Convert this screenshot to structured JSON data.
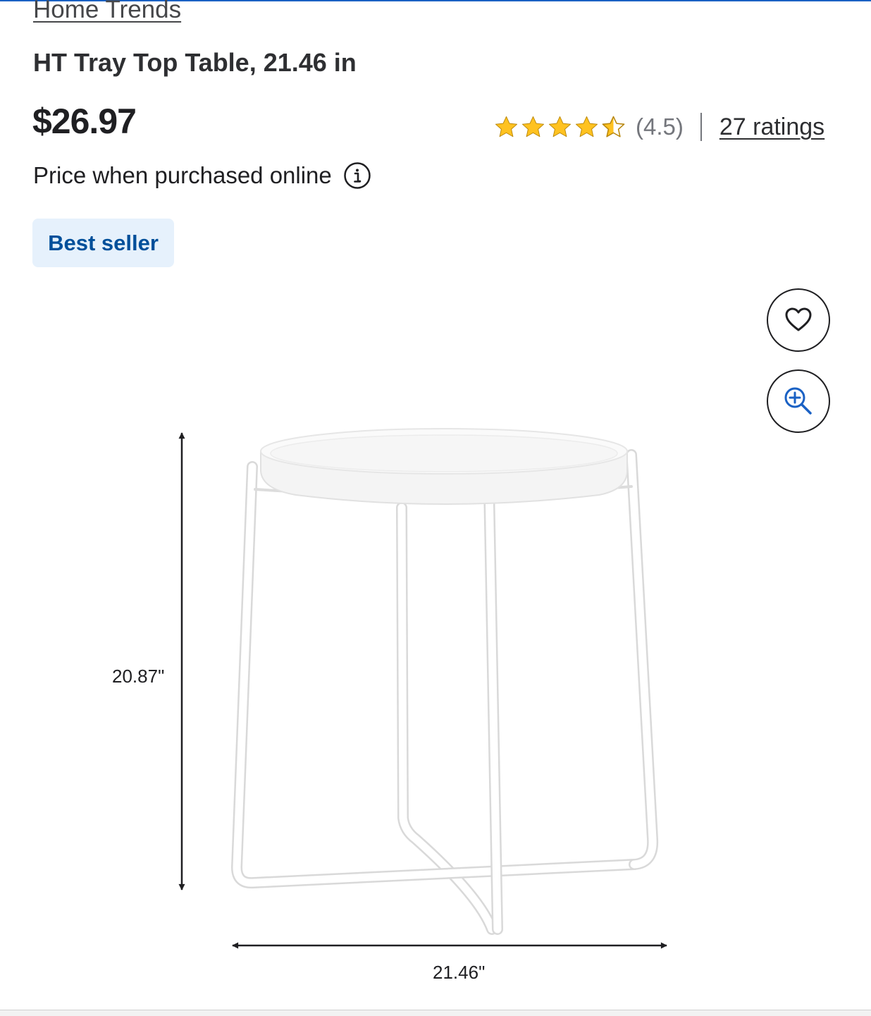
{
  "brand": {
    "label": "Home Trends"
  },
  "product": {
    "title": "HT Tray Top Table, 21.46 in",
    "price": "$26.97",
    "price_note": "Price when purchased online",
    "badge": "Best seller"
  },
  "rating": {
    "stars": 4.5,
    "value_text": "(4.5)",
    "count_text": "27 ratings",
    "star_color": "#ffc220"
  },
  "image": {
    "height_label": "20.87\"",
    "width_label": "21.46\""
  },
  "icons": {
    "info": "info-icon",
    "favorite": "heart-icon",
    "zoom": "zoom-in-icon"
  },
  "colors": {
    "accent": "#1a61c4",
    "badge_bg": "#e6f1fc",
    "badge_text": "#004f9a"
  }
}
